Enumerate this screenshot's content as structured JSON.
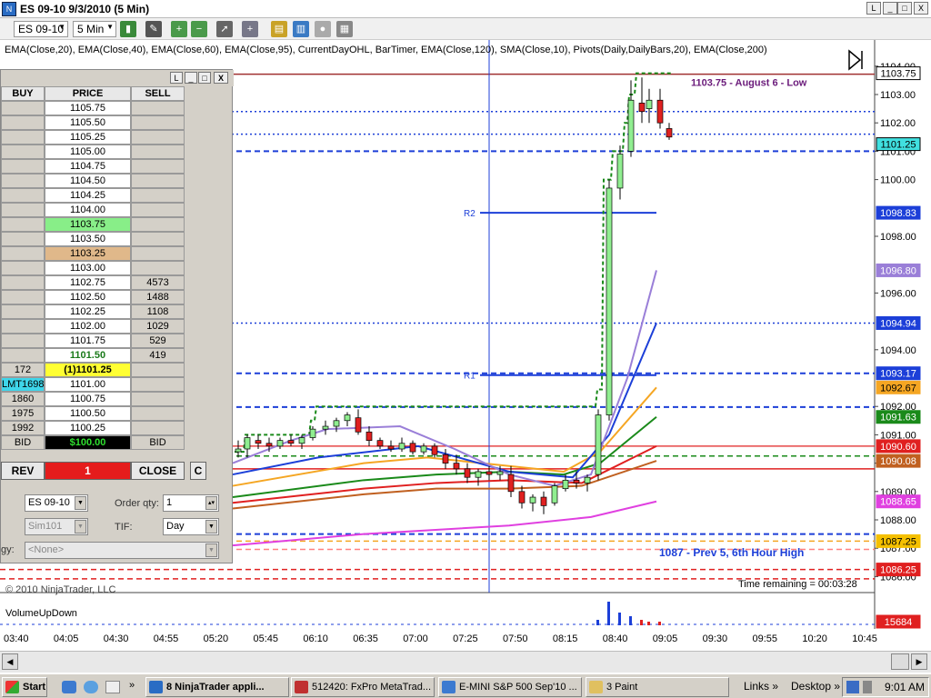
{
  "window": {
    "title": "ES 09-10  9/3/2010 (5 Min)",
    "app_icon": "ninjatrader-icon",
    "controls": [
      "L",
      "_",
      "□",
      "X"
    ]
  },
  "toolbar": {
    "instrument": "ES 09-10",
    "interval": "5 Min",
    "icons": [
      "candlestick-icon",
      "pencil-draw-icon",
      "zoom-in-icon",
      "zoom-out-icon",
      "cursor-icon",
      "crosshair-icon",
      "folder-icon",
      "chart-icon",
      "stop-icon",
      "properties-icon"
    ]
  },
  "indicators_label": "EMA(Close,20), EMA(Close,40), EMA(Close,60), EMA(Close,95), CurrentDayOHL, BarTimer, EMA(Close,120), SMA(Close,10), Pivots(Daily,DailyBars,20), EMA(Close,200)",
  "price_axis": {
    "ticks": [
      "1104.00",
      "1103.00",
      "1102.00",
      "1101.00",
      "1100.00",
      "1098.00",
      "1096.00",
      "1094.00",
      "1092.00",
      "1091.00",
      "1090.00",
      "1089.00",
      "1088.00",
      "1087.00",
      "1086.00"
    ],
    "markers": [
      {
        "label": "1103.75",
        "bg": "#ffffff",
        "fg": "#000000",
        "border": "#000000"
      },
      {
        "label": "1101.25",
        "bg": "#40e0e0",
        "fg": "#000000",
        "border": "#000000"
      },
      {
        "label": "1098.83",
        "bg": "#1c3fd8",
        "fg": "#ffffff",
        "border": "#1c3fd8"
      },
      {
        "label": "1096.80",
        "bg": "#9a7fd8",
        "fg": "#ffffff",
        "border": "#9a7fd8"
      },
      {
        "label": "1094.94",
        "bg": "#1c3fd8",
        "fg": "#ffffff",
        "border": "#1c3fd8"
      },
      {
        "label": "1093.17",
        "bg": "#1c3fd8",
        "fg": "#ffffff",
        "border": "#1c3fd8"
      },
      {
        "label": "1092.67",
        "bg": "#f5a623",
        "fg": "#000000",
        "border": "#f5a623"
      },
      {
        "label": "1091.63",
        "bg": "#1a8a1a",
        "fg": "#ffffff",
        "border": "#1a8a1a"
      },
      {
        "label": "1090.60",
        "bg": "#e02020",
        "fg": "#ffffff",
        "border": "#e02020"
      },
      {
        "label": "1090.08",
        "bg": "#c06020",
        "fg": "#ffffff",
        "border": "#c06020"
      },
      {
        "label": "1088.65",
        "bg": "#e040e0",
        "fg": "#ffffff",
        "border": "#e040e0"
      },
      {
        "label": "1087.25",
        "bg": "#f5c000",
        "fg": "#000000",
        "border": "#f5c000"
      },
      {
        "label": "1086.25",
        "bg": "#e02020",
        "fg": "#ffffff",
        "border": "#e02020"
      },
      {
        "label": "15684",
        "bg": "#e02020",
        "fg": "#ffffff",
        "border": "#e02020"
      }
    ]
  },
  "annotations": {
    "august_low": "1103.75 - August 6 - Low",
    "prev5": "1087 - Prev 5, 6th Hour High",
    "r2": "R2",
    "r1": "R1",
    "time_remaining": "Time remaining = 00:03:28",
    "copyright": "© 2010 NinjaTrader, LLC",
    "volume_label": "VolumeUpDown"
  },
  "time_axis": [
    "03:40",
    "04:05",
    "04:30",
    "04:55",
    "05:20",
    "05:45",
    "06:10",
    "06:35",
    "07:00",
    "07:25",
    "07:50",
    "08:15",
    "08:40",
    "09:05",
    "09:30",
    "09:55",
    "10:20",
    "10:45"
  ],
  "chart_colors": {
    "ema20": "#9a7fd8",
    "ema40": "#1c3fd8",
    "ema60": "#f5a623",
    "ema95": "#1a8a1a",
    "ema120": "#e02020",
    "sma10": "#c06020",
    "ema200": "#e040e0",
    "up_candle": "#90ee90",
    "down_candle": "#e02020",
    "ohl": "#1a8a1a"
  },
  "dom": {
    "title_controls": [
      "L",
      "_",
      "□",
      "X"
    ],
    "headers": {
      "buy": "BUY",
      "price": "PRICE",
      "sell": "SELL"
    },
    "rows": [
      {
        "buy": "",
        "price": "1105.75",
        "sell": "",
        "hl": ""
      },
      {
        "buy": "",
        "price": "1105.50",
        "sell": "",
        "hl": ""
      },
      {
        "buy": "",
        "price": "1105.25",
        "sell": "",
        "hl": ""
      },
      {
        "buy": "",
        "price": "1105.00",
        "sell": "",
        "hl": ""
      },
      {
        "buy": "",
        "price": "1104.75",
        "sell": "",
        "hl": ""
      },
      {
        "buy": "",
        "price": "1104.50",
        "sell": "",
        "hl": ""
      },
      {
        "buy": "",
        "price": "1104.25",
        "sell": "",
        "hl": ""
      },
      {
        "buy": "",
        "price": "1104.00",
        "sell": "",
        "hl": ""
      },
      {
        "buy": "",
        "price": "1103.75",
        "sell": "",
        "hl": "high"
      },
      {
        "buy": "",
        "price": "1103.50",
        "sell": "",
        "hl": ""
      },
      {
        "buy": "",
        "price": "1103.25",
        "sell": "",
        "hl": "open"
      },
      {
        "buy": "",
        "price": "1103.00",
        "sell": "",
        "hl": ""
      },
      {
        "buy": "",
        "price": "1102.75",
        "sell": "4573",
        "hl": ""
      },
      {
        "buy": "",
        "price": "1102.50",
        "sell": "1488",
        "hl": ""
      },
      {
        "buy": "",
        "price": "1102.25",
        "sell": "1108",
        "hl": ""
      },
      {
        "buy": "",
        "price": "1102.00",
        "sell": "1029",
        "hl": ""
      },
      {
        "buy": "",
        "price": "1101.75",
        "sell": "529",
        "hl": ""
      },
      {
        "buy": "",
        "price": "1101.50",
        "sell": "419",
        "hl": "ask"
      },
      {
        "buy": "172",
        "price": "(1)1101.25",
        "sell": "",
        "hl": "last"
      },
      {
        "buy": "LMT1698",
        "price": "1101.00",
        "sell": "",
        "hl": "order"
      },
      {
        "buy": "1860",
        "price": "1100.75",
        "sell": "",
        "hl": ""
      },
      {
        "buy": "1975",
        "price": "1100.50",
        "sell": "",
        "hl": ""
      },
      {
        "buy": "1992",
        "price": "1100.25",
        "sell": "",
        "hl": ""
      },
      {
        "buy": "BID",
        "price": "$100.00",
        "sell": "BID",
        "hl": "pnl"
      }
    ],
    "rev": "REV",
    "qty_display": "1",
    "close": "CLOSE",
    "c": "C",
    "instrument": "ES 09-10",
    "order_qty_label": "Order qty:",
    "order_qty": "1",
    "account": "Sim101",
    "tif_label": "TIF:",
    "tif": "Day",
    "strategy_label": "gy:",
    "strategy": "<None>"
  },
  "taskbar": {
    "start": "Start",
    "buttons": [
      "8 NinjaTrader appli...",
      "512420: FxPro MetaTrad...",
      "E-MINI S&P 500 Sep'10 ...",
      "3 Paint"
    ],
    "links": "Links",
    "desktop": "Desktop",
    "clock": "9:01 AM"
  }
}
